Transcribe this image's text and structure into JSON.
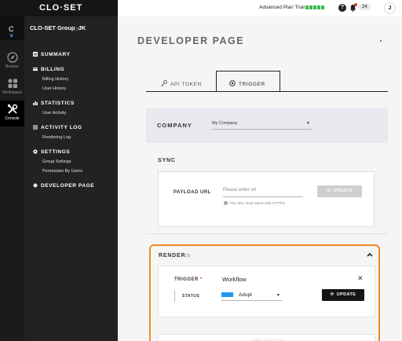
{
  "header": {
    "logo": "CLO·SET",
    "plan_text": "Advanced Plan Trial",
    "notification_count": "24",
    "avatar_initial": "J"
  },
  "rail": {
    "group_initial": "C",
    "items": [
      {
        "label": "Browse",
        "icon": "compass-icon"
      },
      {
        "label": "Workspace",
        "icon": "grid-icon"
      },
      {
        "label": "Console",
        "icon": "tools-icon"
      }
    ]
  },
  "nav": {
    "group_name": "CLO-SET Group_JK",
    "summary": "SUMMARY",
    "billing": "BILLING",
    "billing_history": "Billing History",
    "user_history": "User History",
    "statistics": "STATISTICS",
    "user_activity": "User Activity",
    "activity_log": "ACTIVITY LOG",
    "rendering_log": "Rendering Log",
    "settings": "SETTINGS",
    "group_settings": "Group Settings",
    "permission_by_users": "Permission By Users",
    "developer_page": "DEVELOPER PAGE"
  },
  "main": {
    "title": "DEVELOPER PAGE",
    "tabs": [
      {
        "label": "API TOKEN",
        "active": false
      },
      {
        "label": "TRIGGER",
        "active": true
      }
    ],
    "company": {
      "label": "COMPANY",
      "selected": "My Company"
    },
    "sync": {
      "title": "SYNC",
      "payload_label": "PAYLOAD URL",
      "payload_placeholder": "Please enter url",
      "hint": "The URL must starts with HTTPS.",
      "update_label": "UPDATE"
    },
    "render": {
      "title": "RENDER",
      "count": "(0)",
      "trigger_label": "TRIGGER",
      "required_mark": "*",
      "trigger_value": "Workflow",
      "status_label": "STATUS",
      "status_value": "Adopt",
      "status_color": "#2196f3",
      "update_label": "UPDATE",
      "add_trigger_label": "+ ADD TRIGGER"
    }
  },
  "colors": {
    "highlight": "#f08a24",
    "plan_bars": "#3cba4b",
    "sidebar_bg": "#222222"
  }
}
